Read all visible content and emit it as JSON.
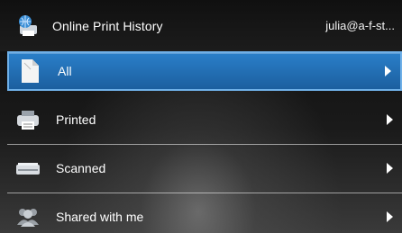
{
  "header": {
    "title": "Online Print History",
    "account": "julia@a-f-st...",
    "icon": "printer-globe-icon"
  },
  "menu": {
    "items": [
      {
        "label": "All",
        "icon": "document-icon",
        "selected": true
      },
      {
        "label": "Printed",
        "icon": "printer-icon",
        "selected": false
      },
      {
        "label": "Scanned",
        "icon": "scanner-icon",
        "selected": false
      },
      {
        "label": "Shared with me",
        "icon": "people-icon",
        "selected": false
      }
    ]
  },
  "colors": {
    "selected_bg": "#2270b4",
    "selected_border": "#6fb0e8",
    "text": "#ffffff"
  }
}
